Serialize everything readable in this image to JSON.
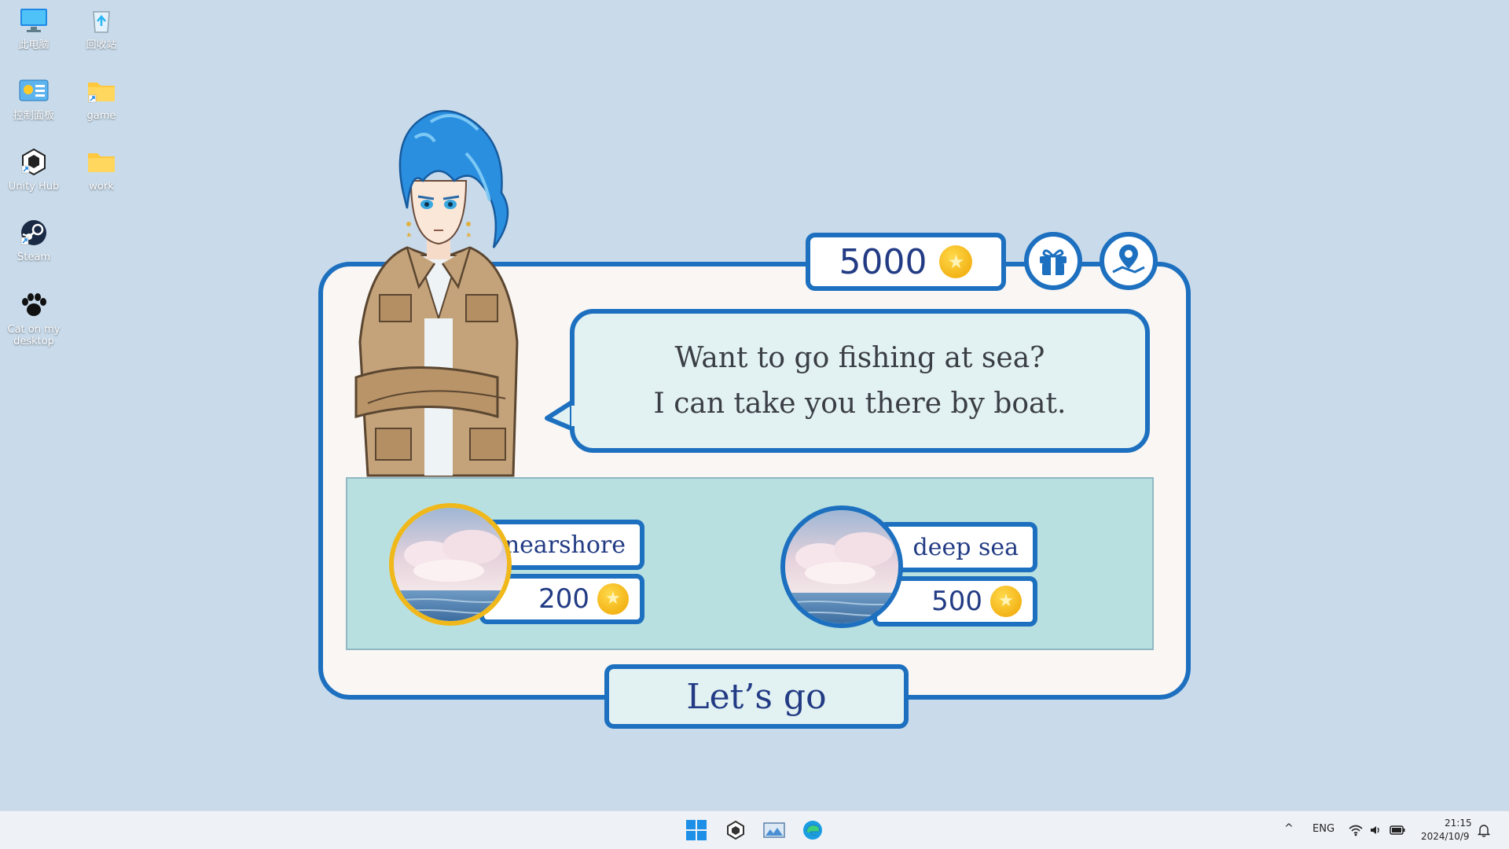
{
  "desktop": {
    "icons": [
      {
        "label": "此电脑",
        "icon": "monitor-icon"
      },
      {
        "label": "回收站",
        "icon": "recycle-bin-icon"
      },
      {
        "label": "控制面板",
        "icon": "control-panel-icon"
      },
      {
        "label": "game",
        "icon": "folder-shortcut-icon"
      },
      {
        "label": "Unity Hub",
        "icon": "unity-hub-icon"
      },
      {
        "label": "work",
        "icon": "folder-icon"
      },
      {
        "label": "Steam",
        "icon": "steam-icon"
      },
      {
        "label": "Cat on my desktop",
        "icon": "paw-icon"
      }
    ]
  },
  "game": {
    "coins": "5000",
    "gift_icon": "gift-icon",
    "map_icon": "map-pin-icon",
    "dialogue": {
      "line1": "Want to go fishing at sea?",
      "line2": "I can take you there by boat."
    },
    "options": [
      {
        "label": "nearshore",
        "price": "200",
        "selected": true
      },
      {
        "label": "deep sea",
        "price": "500",
        "selected": false
      }
    ],
    "go_label": "Let’s go"
  },
  "taskbar": {
    "apps": [
      "windows-start-icon",
      "unity-app-icon",
      "image-app-icon",
      "edge-icon"
    ],
    "tray": {
      "language": "ENG",
      "time": "21:15",
      "date": "2024/10/9"
    }
  },
  "colors": {
    "accent": "#1d70bf",
    "text_dark": "#223b84",
    "coin": "#f3b418",
    "desktop_bg": "#c9dbeb"
  }
}
